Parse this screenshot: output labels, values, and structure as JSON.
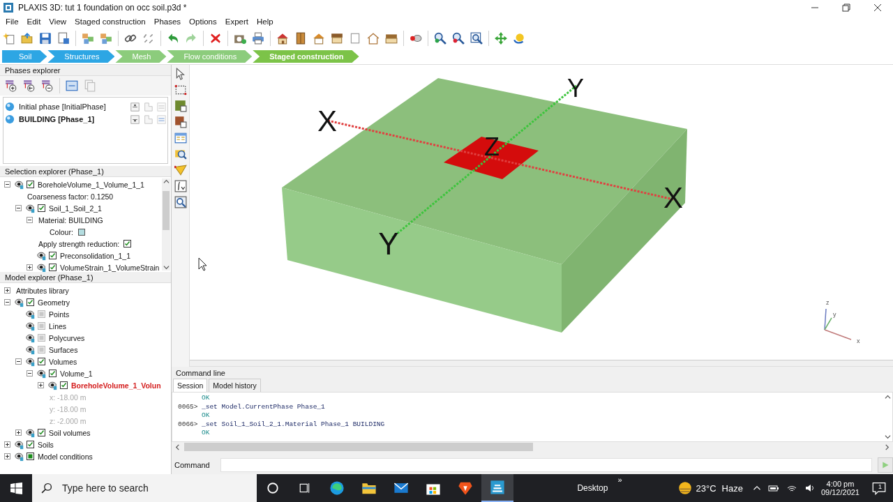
{
  "window": {
    "title": "PLAXIS 3D: tut 1 foundation on occ soil.p3d *"
  },
  "menu": [
    "File",
    "Edit",
    "View",
    "Staged construction",
    "Phases",
    "Options",
    "Expert",
    "Help"
  ],
  "mode_tabs": [
    {
      "label": "Soil",
      "kind": "input",
      "selected": false
    },
    {
      "label": "Structures",
      "kind": "input",
      "selected": false
    },
    {
      "label": "Mesh",
      "kind": "calc",
      "selected": false
    },
    {
      "label": "Flow conditions",
      "kind": "calc",
      "selected": false
    },
    {
      "label": "Staged construction",
      "kind": "calc",
      "selected": true
    }
  ],
  "phases_explorer": {
    "title": "Phases explorer",
    "phases": [
      {
        "label": "Initial phase [InitialPhase]",
        "selected": false
      },
      {
        "label": "BUILDING [Phase_1]",
        "selected": true
      }
    ]
  },
  "selection_explorer": {
    "title": "Selection explorer (Phase_1)",
    "tree": [
      {
        "label": "BoreholeVolume_1_Volume_1_1",
        "kind": "object",
        "checked": true,
        "expanded": true,
        "children": [
          {
            "label": "Coarseness factor: 0.1250",
            "kind": "property"
          },
          {
            "label": "Soil_1_Soil_2_1",
            "kind": "object",
            "checked": true,
            "expanded": true,
            "children": [
              {
                "label": "Material: BUILDING",
                "kind": "property",
                "expanded": true,
                "children": [
                  {
                    "label": "Colour:",
                    "kind": "colour",
                    "color": "#b4dde0"
                  }
                ]
              },
              {
                "label": "Apply strength reduction:",
                "kind": "flag",
                "checked": true
              },
              {
                "label": "Preconsolidation_1_1",
                "kind": "object",
                "checked": true
              },
              {
                "label": "VolumeStrain_1_VolumeStrain",
                "kind": "object",
                "checked": true,
                "expanded": false
              }
            ]
          }
        ]
      }
    ]
  },
  "model_explorer": {
    "title": "Model explorer (Phase_1)",
    "tree": [
      {
        "label": "Attributes library",
        "kind": "group",
        "expanded": false,
        "selected": false
      },
      {
        "label": "Geometry",
        "kind": "object",
        "checked": true,
        "expanded": true,
        "selected": false,
        "children": [
          {
            "label": "Points",
            "kind": "object",
            "checked": false,
            "disabled": true,
            "selected": false
          },
          {
            "label": "Lines",
            "kind": "object",
            "checked": false,
            "disabled": true,
            "selected": false
          },
          {
            "label": "Polycurves",
            "kind": "object",
            "checked": false,
            "disabled": true,
            "selected": false
          },
          {
            "label": "Surfaces",
            "kind": "object",
            "checked": false,
            "disabled": true,
            "selected": false
          },
          {
            "label": "Volumes",
            "kind": "object",
            "checked": true,
            "expanded": true,
            "selected": false,
            "children": [
              {
                "label": "Volume_1",
                "kind": "object",
                "checked": true,
                "expanded": true,
                "selected": false,
                "children": [
                  {
                    "label": "BoreholeVolume_1_Volun",
                    "kind": "object",
                    "checked": true,
                    "expanded": false,
                    "selected": true
                  },
                  {
                    "label": "x: -18.00 m",
                    "kind": "coordinate"
                  },
                  {
                    "label": "y: -18.00 m",
                    "kind": "coordinate"
                  },
                  {
                    "label": "z: -2.000 m",
                    "kind": "coordinate"
                  }
                ]
              }
            ]
          },
          {
            "label": "Soil volumes",
            "kind": "object",
            "checked": true,
            "expanded": false,
            "selected": false
          }
        ]
      },
      {
        "label": "Soils",
        "kind": "object",
        "checked": true,
        "expanded": false,
        "selected": false
      },
      {
        "label": "Model conditions",
        "kind": "object",
        "checked": false,
        "partial": true,
        "expanded": false,
        "selected": false
      }
    ]
  },
  "viewport": {
    "axis_labels": [
      {
        "text": "X",
        "kind": "x"
      },
      {
        "text": "Y",
        "kind": "y"
      },
      {
        "text": "Z",
        "kind": "z"
      },
      {
        "text": "X",
        "kind": "x2"
      },
      {
        "text": "Y",
        "kind": "y2"
      }
    ],
    "triad_labels": [
      {
        "text": "z",
        "kind": "z"
      },
      {
        "text": "y",
        "kind": "y"
      },
      {
        "text": "x",
        "kind": "x"
      }
    ]
  },
  "command_line": {
    "title": "Command line",
    "tabs": [
      {
        "label": "Session",
        "selected": true
      },
      {
        "label": "Model history",
        "selected": false
      }
    ],
    "log": [
      {
        "text": "OK",
        "kind": "response"
      },
      {
        "number": "0065>",
        "text": "_set Model.CurrentPhase Phase_1",
        "kind": "command"
      },
      {
        "text": "OK",
        "kind": "response"
      },
      {
        "number": "0066>",
        "text": "_set Soil_1_Soil_2_1.Material Phase_1 BUILDING",
        "kind": "command"
      },
      {
        "text": "OK",
        "kind": "response"
      }
    ],
    "command_label": "Command"
  },
  "taskbar": {
    "search_placeholder": "Type here to search",
    "desktop": "Desktop",
    "chevron": "»",
    "temperature": "23°C",
    "weather": "Haze",
    "time": "4:00 pm",
    "date": "09/12/2021",
    "notifications": "1"
  }
}
